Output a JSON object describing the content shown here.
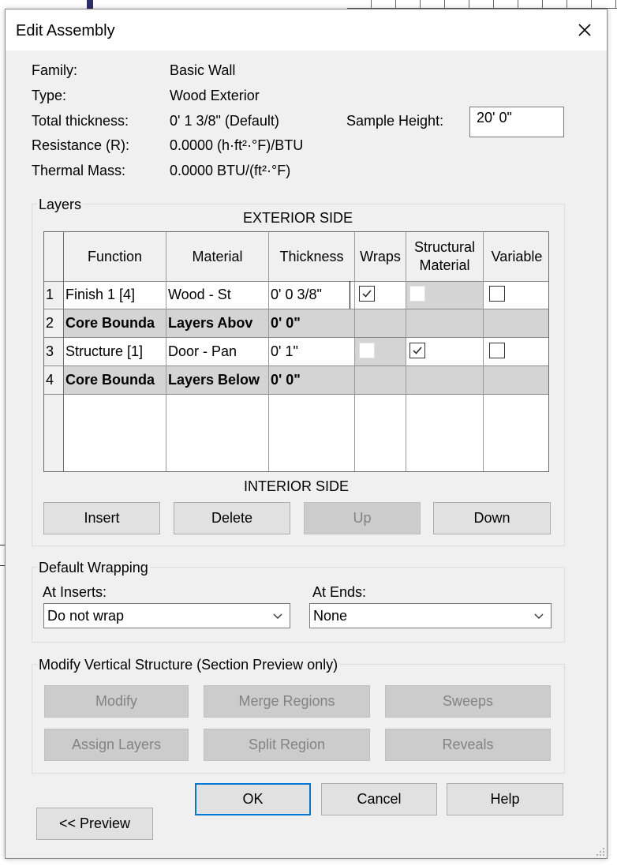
{
  "dialog": {
    "title": "Edit Assembly"
  },
  "info": {
    "family_label": "Family:",
    "family_value": "Basic Wall",
    "type_label": "Type:",
    "type_value": "Wood Exterior",
    "total_label": "Total thickness:",
    "total_value": "0'  1 3/8\" (Default)",
    "resistance_label": "Resistance (R):",
    "resistance_value": "0.0000 (h·ft²·°F)/BTU",
    "thermal_label": "Thermal Mass:",
    "thermal_value": "0.0000 BTU/(ft²·°F)",
    "sample_label": "Sample Height:",
    "sample_value": "20'  0\""
  },
  "layers": {
    "group_label": "Layers",
    "exterior_side": "EXTERIOR SIDE",
    "interior_side": "INTERIOR SIDE",
    "columns": {
      "function": "Function",
      "material": "Material",
      "thickness": "Thickness",
      "wraps": "Wraps",
      "structural_1": "Structural",
      "structural_2": "Material",
      "variable": "Variable"
    },
    "rows": [
      {
        "num": "1",
        "function": "Finish 1 [4]",
        "material": "Wood - St",
        "thickness": "0'  0 3/8\"",
        "wraps": true,
        "structural": false,
        "variable": false
      },
      {
        "num": "2",
        "function": "Core Bounda",
        "material": "Layers Abov",
        "thickness": "0'  0\""
      },
      {
        "num": "3",
        "function": "Structure [1]",
        "material": "Door - Pan",
        "thickness": "0'  1\"",
        "wraps": false,
        "structural": true,
        "variable": false
      },
      {
        "num": "4",
        "function": "Core Bounda",
        "material": "Layers Below",
        "thickness": "0'  0\""
      }
    ],
    "buttons": {
      "insert": "Insert",
      "delete": "Delete",
      "up": "Up",
      "down": "Down"
    }
  },
  "wrapping": {
    "group_label": "Default Wrapping",
    "inserts_label": "At Inserts:",
    "inserts_value": "Do not wrap",
    "ends_label": "At  Ends:",
    "ends_value": "None"
  },
  "vertical": {
    "group_label": "Modify Vertical Structure (Section Preview only)",
    "modify": "Modify",
    "merge": "Merge Regions",
    "sweeps": "Sweeps",
    "assign": "Assign Layers",
    "split": "Split Region",
    "reveals": "Reveals"
  },
  "footer": {
    "ok": "OK",
    "cancel": "Cancel",
    "help": "Help",
    "preview": "<< Preview"
  },
  "colors": {
    "focus_border": "#0078d7",
    "disabled_button": "#cccccc",
    "gray_row": "#d4d4d4"
  }
}
